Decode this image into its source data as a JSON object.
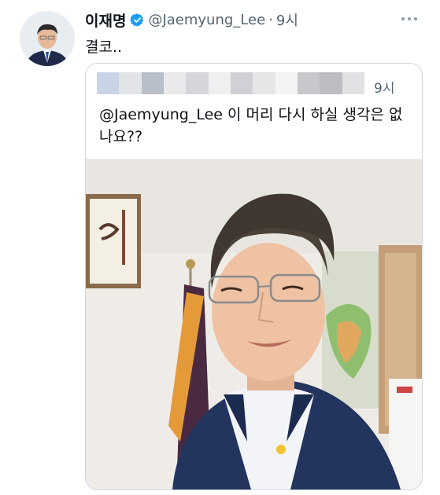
{
  "tweet": {
    "author_name": "이재명",
    "author_handle": "@Jaemyung_Lee",
    "separator": "·",
    "time": "9시",
    "text": "결코.."
  },
  "quoted_tweet": {
    "time": "9시",
    "mention": "@Jaemyung_Lee",
    "text_rest": " 이 머리 다시 하실 생각은 없나요??"
  },
  "icons": {
    "verified": "verified-badge-icon",
    "more": "more-options-icon"
  },
  "colors": {
    "verified_blue": "#1d9bf0",
    "secondary_text": "#536471",
    "border": "#cfd9de"
  }
}
